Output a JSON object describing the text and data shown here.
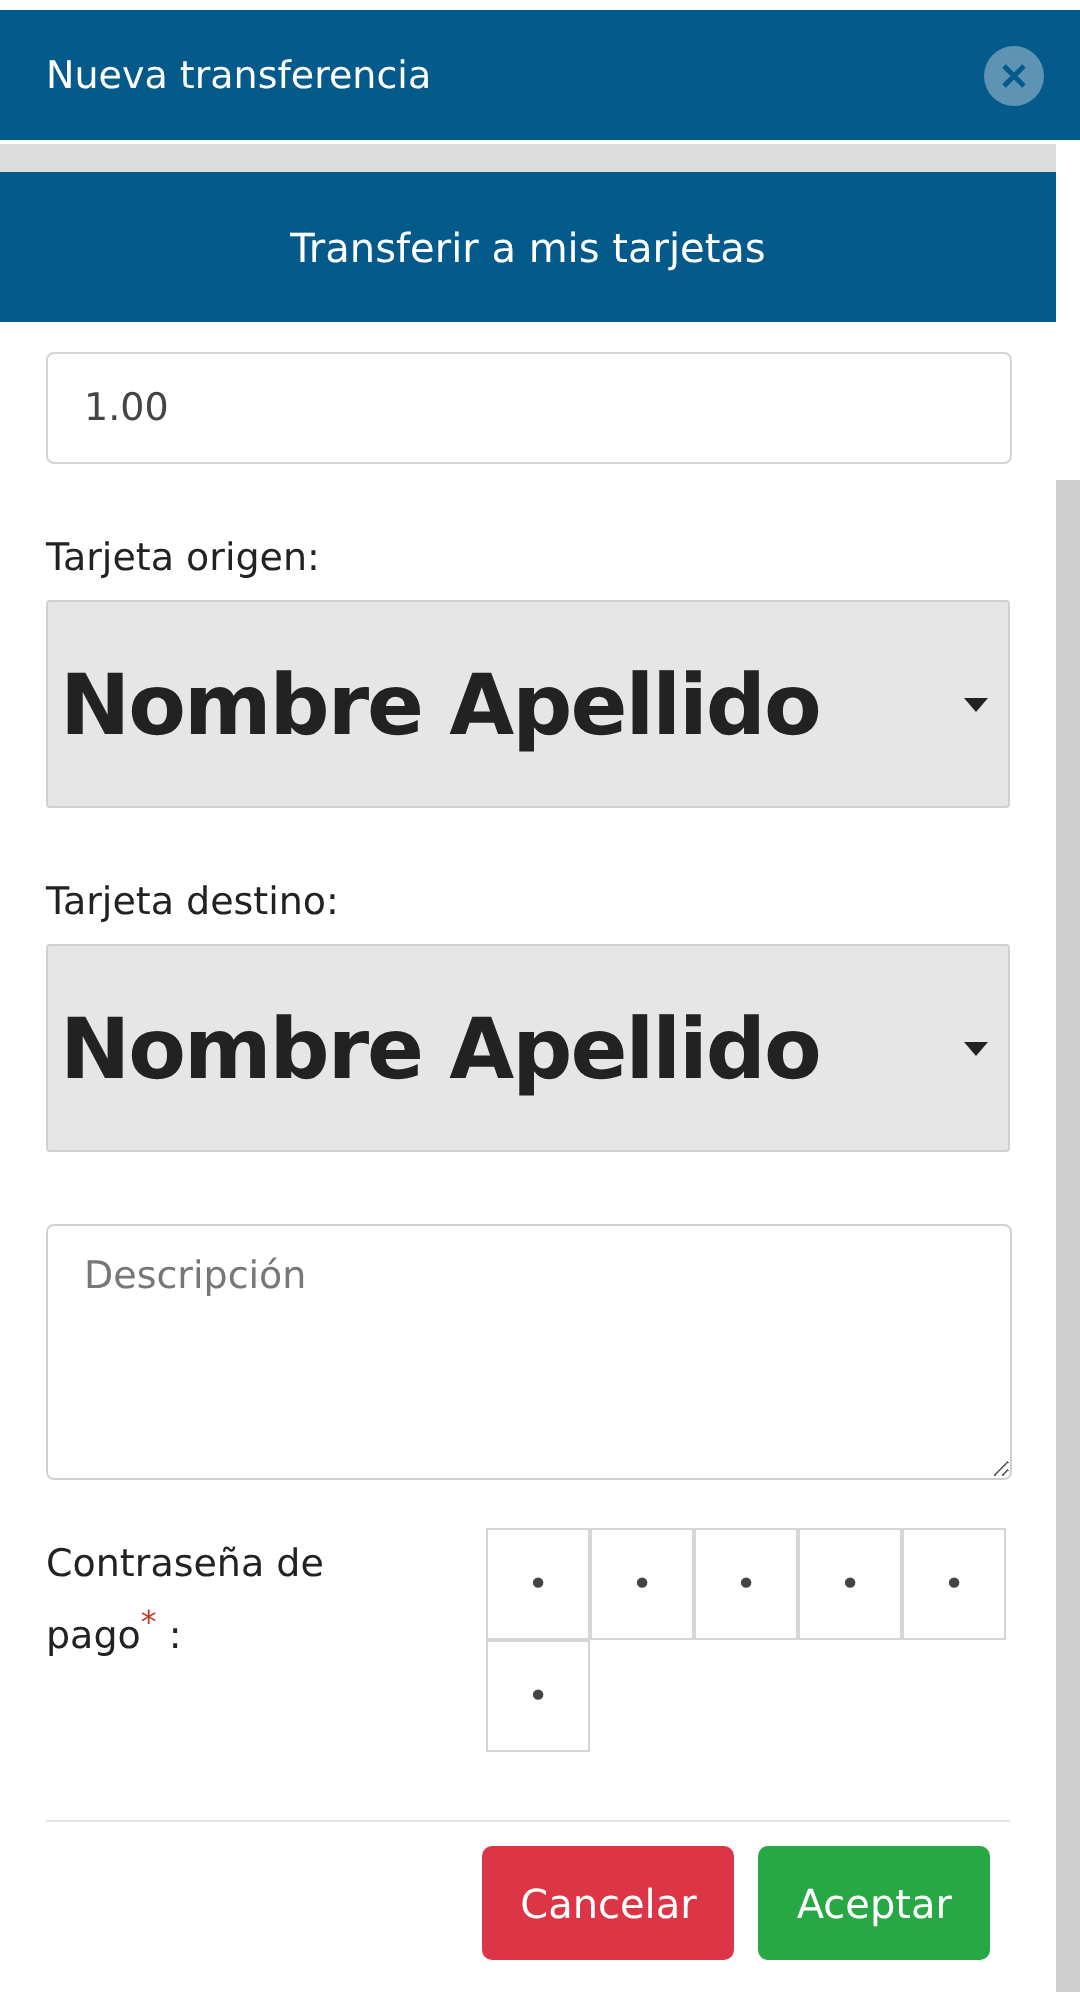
{
  "window": {
    "title": "Nueva transferencia"
  },
  "tab": {
    "label": "Transferir a mis tarjetas"
  },
  "amount": {
    "value": "1.00"
  },
  "source_card": {
    "label": "Tarjeta origen:",
    "value": "Nombre Apellido"
  },
  "target_card": {
    "label": "Tarjeta destino:",
    "value": "Nombre Apellido"
  },
  "description": {
    "placeholder": "Descripción"
  },
  "password": {
    "label": "Contraseña de pago$^{*}$ :",
    "digits": [
      "•",
      "•",
      "•",
      "•",
      "•",
      "•"
    ]
  },
  "buttons": [
    {
      "label": "Cancelar",
      "kind": "danger"
    },
    {
      "label": "Aceptar",
      "kind": "success"
    }
  ]
}
